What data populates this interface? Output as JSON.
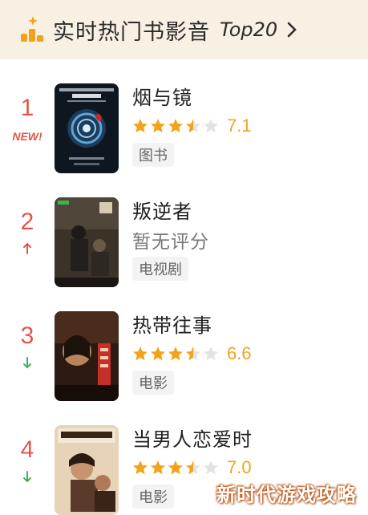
{
  "header": {
    "title": "实时热门书影音",
    "tag": "Top20"
  },
  "items": [
    {
      "rank": "1",
      "badge": "NEW!",
      "trend": "new",
      "title": "烟与镜",
      "rating": 3.5,
      "score": "7.1",
      "category": "图书"
    },
    {
      "rank": "2",
      "trend": "up",
      "title": "叛逆者",
      "no_score": "暂无评分",
      "category": "电视剧"
    },
    {
      "rank": "3",
      "trend": "down",
      "title": "热带往事",
      "rating": 3.5,
      "score": "6.6",
      "category": "电影"
    },
    {
      "rank": "4",
      "trend": "down",
      "title": "当男人恋爱时",
      "rating": 3.5,
      "score": "7.0",
      "category": "电影"
    }
  ],
  "colors": {
    "accent": "#f2a31c",
    "rank": "#e2564a",
    "up": "#e2564a",
    "down": "#3cb35a",
    "header_bg": "#f7f0e3"
  },
  "watermark": "新时代游戏攻略"
}
